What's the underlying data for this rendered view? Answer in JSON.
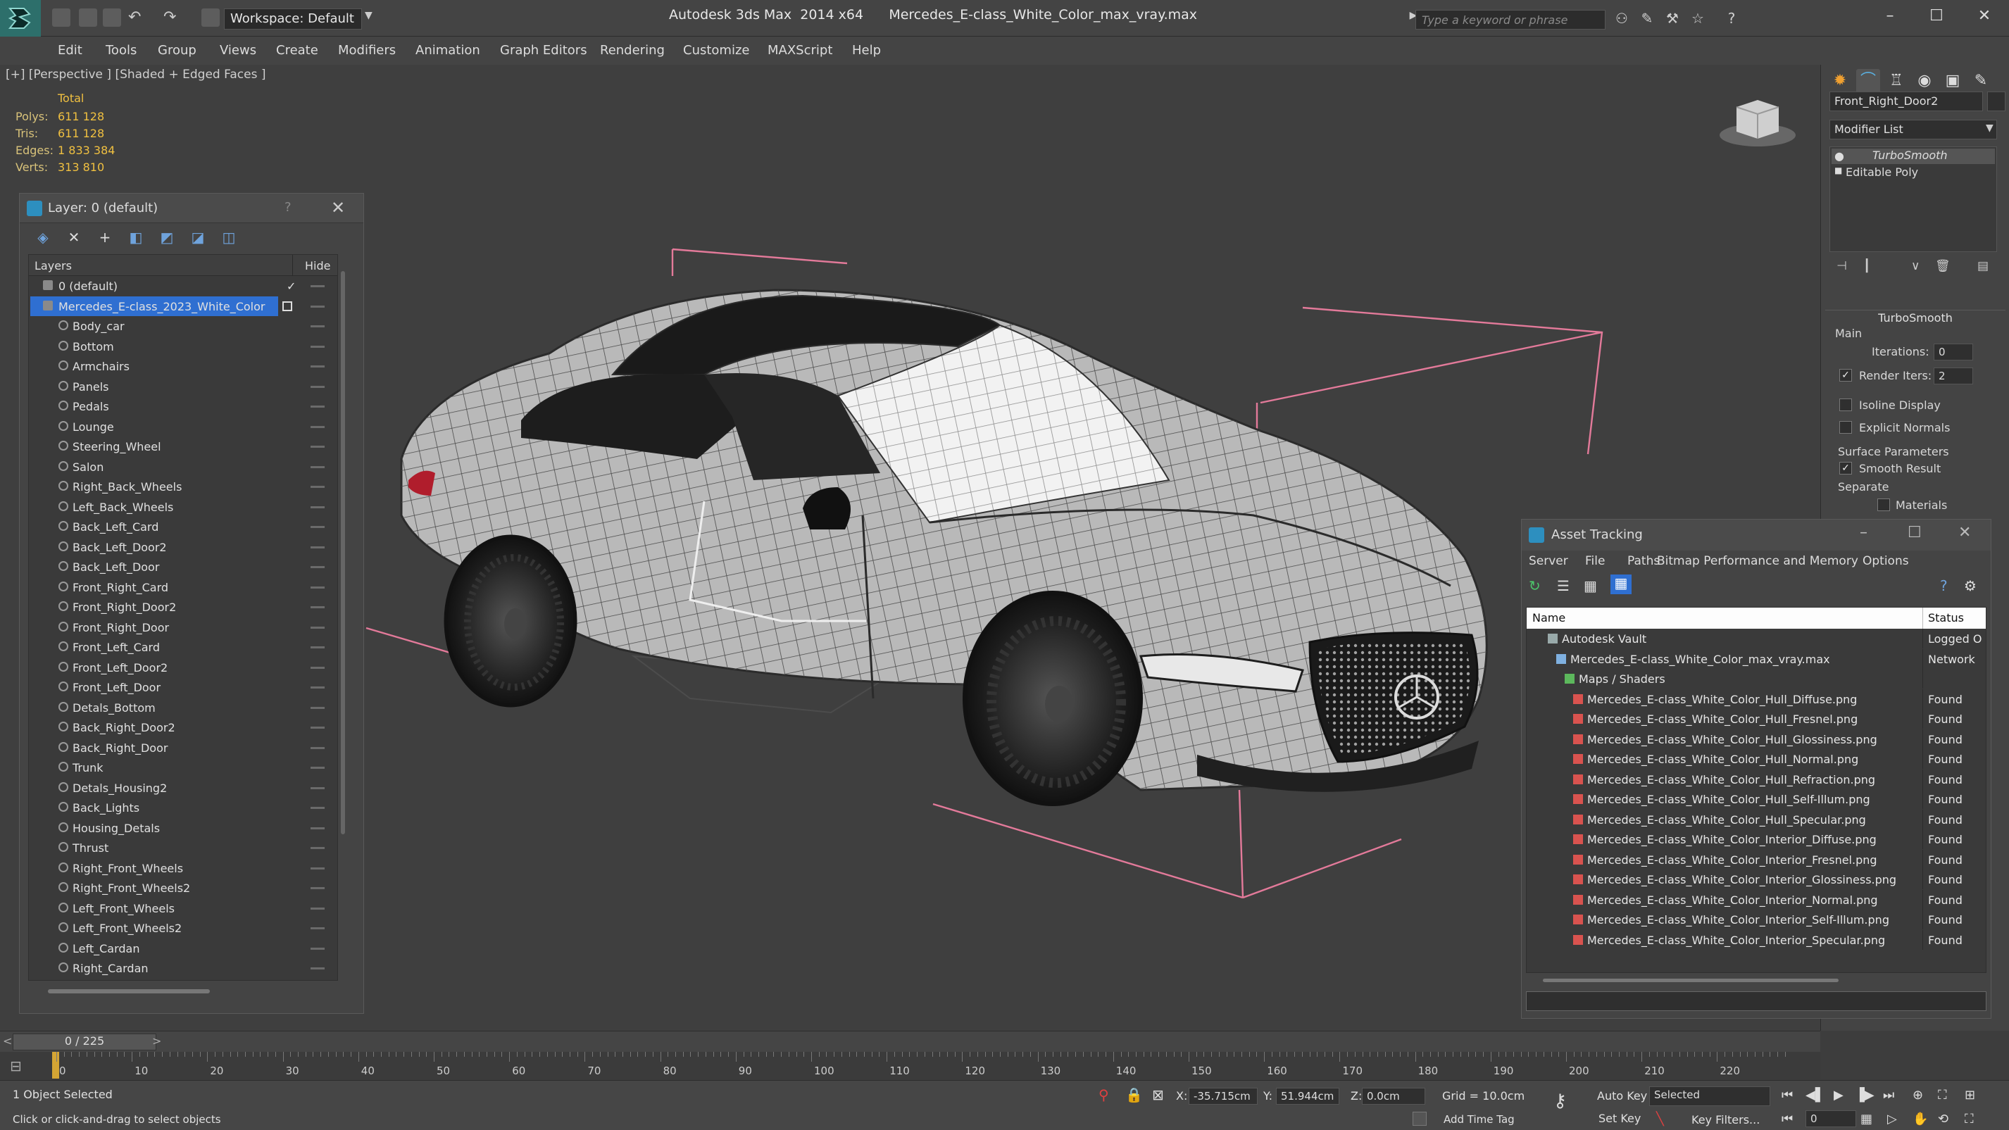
{
  "titlebar": {
    "workspace": "Workspace: Default",
    "app_title": "Autodesk 3ds Max  2014 x64",
    "file_title": "Mercedes_E-class_White_Color_max_vray.max",
    "search_placeholder": "Type a keyword or phrase"
  },
  "menu": [
    "Edit",
    "Tools",
    "Group",
    "Views",
    "Create",
    "Modifiers",
    "Animation",
    "Graph Editors",
    "Rendering",
    "Customize",
    "MAXScript",
    "Help"
  ],
  "viewport": {
    "label": "[+] [Perspective ] [Shaded + Edged Faces ]",
    "stats": {
      "header": "Total",
      "rows": [
        {
          "label": "Polys:",
          "value": "611 128"
        },
        {
          "label": "Tris:",
          "value": "611 128"
        },
        {
          "label": "Edges:",
          "value": "1 833 384"
        },
        {
          "label": "Verts:",
          "value": "313 810"
        }
      ]
    }
  },
  "layer_panel": {
    "title": "Layer: 0 (default)",
    "help": "?",
    "col_layers": "Layers",
    "col_hide": "Hide",
    "rows": [
      {
        "name": "0 (default)",
        "level": 0,
        "check": "✓"
      },
      {
        "name": "Mercedes_E-class_2023_White_Color",
        "level": 0,
        "selected": true
      },
      {
        "name": "Body_car",
        "level": 1
      },
      {
        "name": "Bottom",
        "level": 1
      },
      {
        "name": "Armchairs",
        "level": 1
      },
      {
        "name": "Panels",
        "level": 1
      },
      {
        "name": "Pedals",
        "level": 1
      },
      {
        "name": "Lounge",
        "level": 1
      },
      {
        "name": "Steering_Wheel",
        "level": 1
      },
      {
        "name": "Salon",
        "level": 1
      },
      {
        "name": "Right_Back_Wheels",
        "level": 1
      },
      {
        "name": "Left_Back_Wheels",
        "level": 1
      },
      {
        "name": "Back_Left_Card",
        "level": 1
      },
      {
        "name": "Back_Left_Door2",
        "level": 1
      },
      {
        "name": "Back_Left_Door",
        "level": 1
      },
      {
        "name": "Front_Right_Card",
        "level": 1
      },
      {
        "name": "Front_Right_Door2",
        "level": 1
      },
      {
        "name": "Front_Right_Door",
        "level": 1
      },
      {
        "name": "Front_Left_Card",
        "level": 1
      },
      {
        "name": "Front_Left_Door2",
        "level": 1
      },
      {
        "name": "Front_Left_Door",
        "level": 1
      },
      {
        "name": "Detals_Bottom",
        "level": 1
      },
      {
        "name": "Back_Right_Door2",
        "level": 1
      },
      {
        "name": "Back_Right_Door",
        "level": 1
      },
      {
        "name": "Trunk",
        "level": 1
      },
      {
        "name": "Detals_Housing2",
        "level": 1
      },
      {
        "name": "Back_Lights",
        "level": 1
      },
      {
        "name": "Housing_Detals",
        "level": 1
      },
      {
        "name": "Thrust",
        "level": 1
      },
      {
        "name": "Right_Front_Wheels",
        "level": 1
      },
      {
        "name": "Right_Front_Wheels2",
        "level": 1
      },
      {
        "name": "Left_Front_Wheels",
        "level": 1
      },
      {
        "name": "Left_Front_Wheels2",
        "level": 1
      },
      {
        "name": "Left_Cardan",
        "level": 1
      },
      {
        "name": "Right_Cardan",
        "level": 1
      }
    ]
  },
  "command_panel": {
    "object_name": "Front_Right_Door2",
    "modifier_list": "Modifier List",
    "stack": [
      "TurboSmooth",
      "Editable Poly"
    ],
    "turbosmooth": {
      "title": "TurboSmooth",
      "main": "Main",
      "iterations_label": "Iterations:",
      "iterations": "0",
      "render_iters_label": "Render Iters:",
      "render_iters": "2",
      "isoline": "Isoline Display",
      "explicit": "Explicit Normals",
      "surface": "Surface Parameters",
      "smooth_result": "Smooth Result",
      "separate": "Separate",
      "materials": "Materials"
    }
  },
  "asset_tracking": {
    "title": "Asset Tracking",
    "menu": [
      "Server",
      "File",
      "Paths",
      "Bitmap Performance and Memory",
      "Options"
    ],
    "col_name": "Name",
    "col_status": "Status",
    "rows": [
      {
        "name": "Autodesk Vault",
        "status": "Logged O",
        "level": 0,
        "icon": "vault"
      },
      {
        "name": "Mercedes_E-class_White_Color_max_vray.max",
        "status": "Network",
        "level": 1,
        "icon": "file"
      },
      {
        "name": "Maps / Shaders",
        "status": "",
        "level": 2,
        "icon": "folder"
      },
      {
        "name": "Mercedes_E-class_White_Color_Hull_Diffuse.png",
        "status": "Found",
        "level": 3,
        "icon": "png"
      },
      {
        "name": "Mercedes_E-class_White_Color_Hull_Fresnel.png",
        "status": "Found",
        "level": 3,
        "icon": "png"
      },
      {
        "name": "Mercedes_E-class_White_Color_Hull_Glossiness.png",
        "status": "Found",
        "level": 3,
        "icon": "png"
      },
      {
        "name": "Mercedes_E-class_White_Color_Hull_Normal.png",
        "status": "Found",
        "level": 3,
        "icon": "png"
      },
      {
        "name": "Mercedes_E-class_White_Color_Hull_Refraction.png",
        "status": "Found",
        "level": 3,
        "icon": "png"
      },
      {
        "name": "Mercedes_E-class_White_Color_Hull_Self-Illum.png",
        "status": "Found",
        "level": 3,
        "icon": "png"
      },
      {
        "name": "Mercedes_E-class_White_Color_Hull_Specular.png",
        "status": "Found",
        "level": 3,
        "icon": "png"
      },
      {
        "name": "Mercedes_E-class_White_Color_Interior_Diffuse.png",
        "status": "Found",
        "level": 3,
        "icon": "png"
      },
      {
        "name": "Mercedes_E-class_White_Color_Interior_Fresnel.png",
        "status": "Found",
        "level": 3,
        "icon": "png"
      },
      {
        "name": "Mercedes_E-class_White_Color_Interior_Glossiness.png",
        "status": "Found",
        "level": 3,
        "icon": "png"
      },
      {
        "name": "Mercedes_E-class_White_Color_Interior_Normal.png",
        "status": "Found",
        "level": 3,
        "icon": "png"
      },
      {
        "name": "Mercedes_E-class_White_Color_Interior_Self-Illum.png",
        "status": "Found",
        "level": 3,
        "icon": "png"
      },
      {
        "name": "Mercedes_E-class_White_Color_Interior_Specular.png",
        "status": "Found",
        "level": 3,
        "icon": "png"
      }
    ]
  },
  "timeline": {
    "slider": "0 / 225",
    "ticks": [
      "0",
      "10",
      "20",
      "30",
      "40",
      "50",
      "60",
      "70",
      "80",
      "90",
      "100",
      "110",
      "120",
      "130",
      "140",
      "150",
      "160",
      "170",
      "180",
      "190",
      "200",
      "210",
      "220"
    ]
  },
  "status": {
    "selection": "1 Object Selected",
    "prompt": "Click or click-and-drag to select objects",
    "x_label": "X:",
    "x": "-35.715cm",
    "y_label": "Y:",
    "y": "51.944cm",
    "z_label": "Z:",
    "z": "0.0cm",
    "grid": "Grid = 10.0cm",
    "add_time_tag": "Add Time Tag",
    "auto_key": "Auto Key",
    "set_key": "Set Key",
    "key_mode": "Selected",
    "key_filters": "Key Filters...",
    "frame": "0"
  },
  "colors": {
    "selection_blue": "#2f6fd1",
    "stat_yellow": "#f0c040",
    "bbox_pink": "#e37a9a",
    "time_cursor": "#d4a534"
  }
}
